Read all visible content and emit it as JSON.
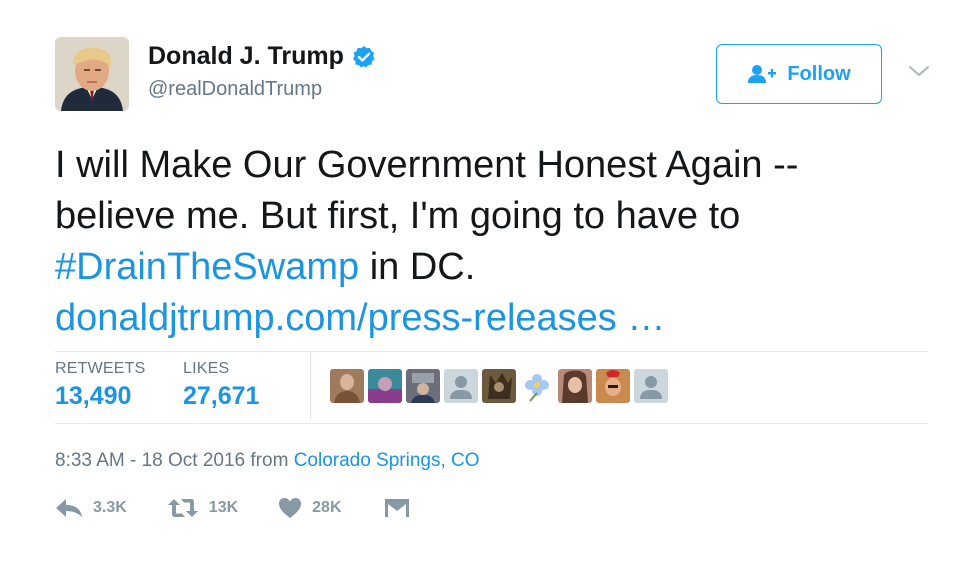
{
  "user": {
    "name": "Donald J. Trump",
    "handle": "@realDonaldTrump",
    "verified": true
  },
  "follow_button": {
    "label": "Follow",
    "icon": "add-user-icon"
  },
  "menu_icon": "chevron-down-icon",
  "tweet": {
    "line1": "I will Make Our Government Honest Again --",
    "line2": "believe me. But first, I'm going to have to",
    "hashtag": "#DrainTheSwamp",
    "after_hashtag": " in DC.",
    "link": "donaldjtrump.com/press-releases",
    "link_ellipsis": " …"
  },
  "stats": {
    "retweets_label": "RETWEETS",
    "retweets_value": "13,490",
    "likes_label": "LIKES",
    "likes_value": "27,671"
  },
  "liker_avatars": [
    {
      "icon": "avatar-photo",
      "color": "#a07a5c"
    },
    {
      "icon": "avatar-photo",
      "color": "#3a8a9a"
    },
    {
      "icon": "avatar-photo",
      "color": "#6c6f7a"
    },
    {
      "icon": "default-avatar-icon",
      "color": "#ccd6dd"
    },
    {
      "icon": "avatar-photo",
      "color": "#6b5a3e"
    },
    {
      "icon": "flower-avatar-icon",
      "color": "#ffffff"
    },
    {
      "icon": "avatar-photo",
      "color": "#b88a7a"
    },
    {
      "icon": "avatar-photo",
      "color": "#c98a4e"
    },
    {
      "icon": "default-avatar-icon",
      "color": "#ccd6dd"
    }
  ],
  "timestamp": {
    "time_date": "8:33 AM - 18 Oct 2016",
    "from": " from ",
    "place": "Colorado Springs, CO"
  },
  "actions": {
    "reply_count": "3.3K",
    "retweet_count": "13K",
    "like_count": "28K"
  },
  "colors": {
    "accent": "#1b95e0",
    "follow_blue": "#1da1f2",
    "muted": "#657786",
    "icon_gray": "#8899a6",
    "divider": "#e1e8ed"
  }
}
